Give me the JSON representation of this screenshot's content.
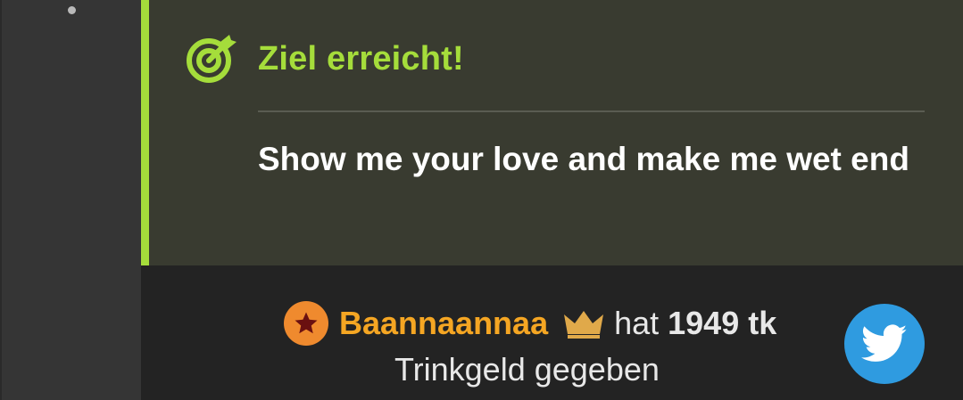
{
  "goal": {
    "title": "Ziel erreicht!",
    "message": "Show me your love and make me wet end",
    "icon": "target-arrow-icon",
    "accent_color": "#a5dd3b"
  },
  "tip": {
    "username": "Baannaannaa",
    "user_badge_icon": "star-icon",
    "rank_icon": "crown-icon",
    "verb": "hat",
    "amount": "1949 tk",
    "suffix": "Trinkgeld gegeben",
    "username_color": "#f5a623"
  },
  "share": {
    "icon": "twitter-bird-icon",
    "color": "#2f9be0"
  }
}
